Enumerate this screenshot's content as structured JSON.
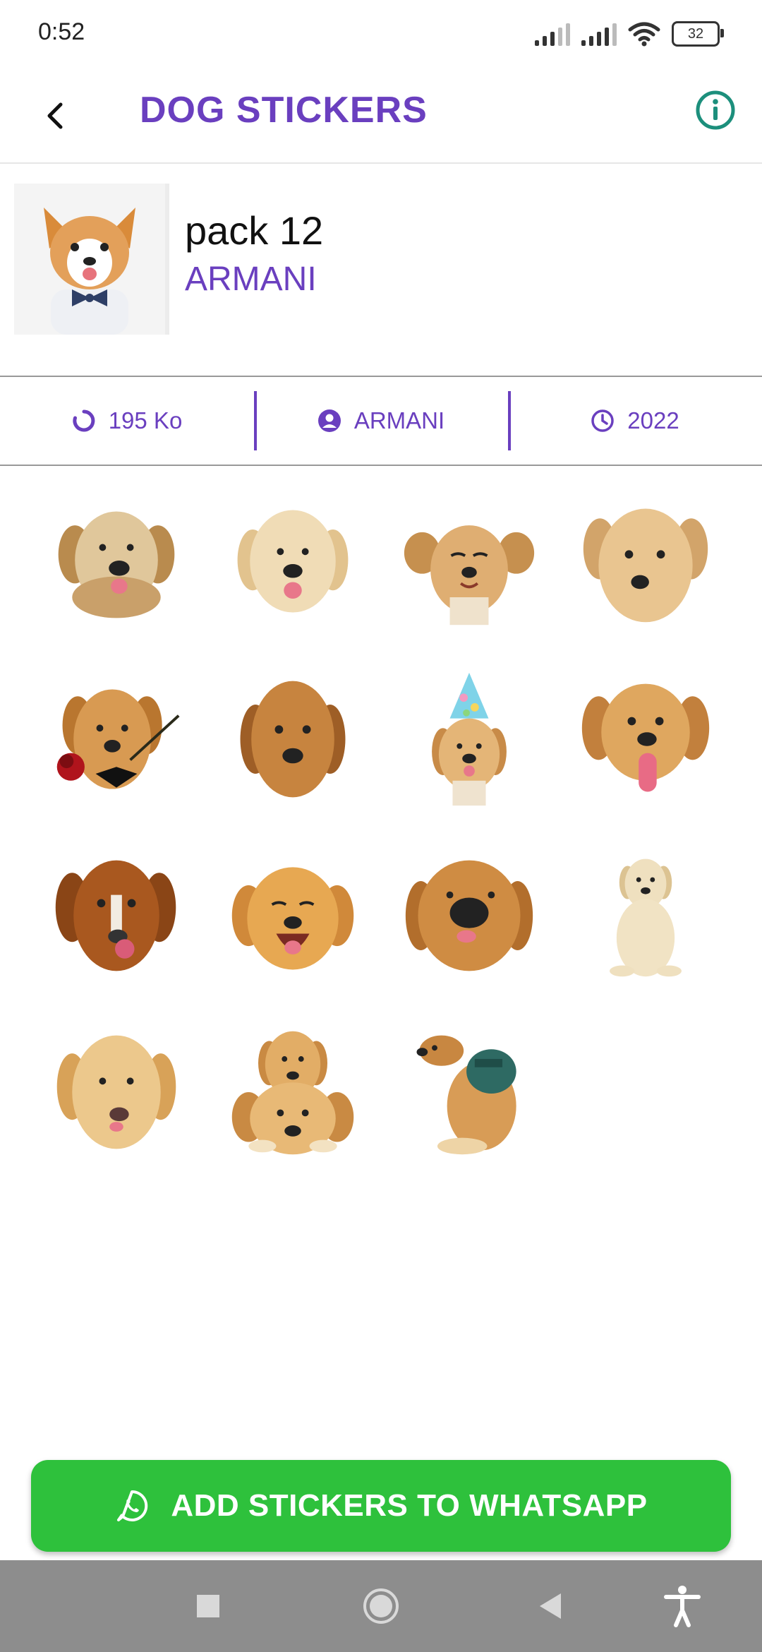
{
  "status_bar": {
    "time": "0:52",
    "battery": "32"
  },
  "app_bar": {
    "title": "DOG STICKERS",
    "back_icon": "arrow-back-icon",
    "info_icon": "info-icon"
  },
  "pack": {
    "name": "pack 12",
    "author": "ARMANI"
  },
  "info_row": {
    "size": "195 Ko",
    "publisher": "ARMANI",
    "year": "2022"
  },
  "stickers": [
    {
      "subject": "golden-retriever-smiling"
    },
    {
      "subject": "cream-golden-retriever"
    },
    {
      "subject": "puppy-eyes-closed"
    },
    {
      "subject": "labrador-puppy-tilted"
    },
    {
      "subject": "dog-with-rose-and-bowtie"
    },
    {
      "subject": "golden-retriever-face"
    },
    {
      "subject": "dog-with-party-hat"
    },
    {
      "subject": "golden-retriever-tongue-out"
    },
    {
      "subject": "red-dog-licking"
    },
    {
      "subject": "golden-retriever-laughing"
    },
    {
      "subject": "golden-retriever-closeup-nose"
    },
    {
      "subject": "labrador-puppy-sitting"
    },
    {
      "subject": "golden-retriever-licking-nose"
    },
    {
      "subject": "two-stacked-retrievers"
    },
    {
      "subject": "dog-with-backpack"
    }
  ],
  "add_button": {
    "label": "ADD STICKERS TO WHATSAPP",
    "icon": "whatsapp-icon"
  },
  "colors": {
    "accent": "#6a3fbf",
    "button": "#2ec13c",
    "info_icon": "#1c8f7c",
    "navbar": "#8d8d8d"
  }
}
